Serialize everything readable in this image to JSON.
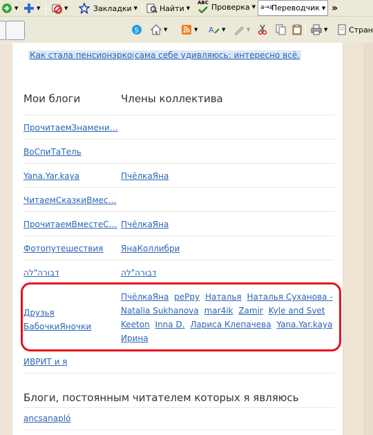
{
  "toolbar": {
    "bookmarks_label": "Закладки",
    "find_label": "Найти",
    "spellcheck_label": "Проверка",
    "spellcheck_badge": "ABC",
    "translate_label": "Переводчик",
    "translate_glyph": "a→a",
    "more_glyph": "»",
    "page_label": "Стран"
  },
  "tags": {
    "tag1": "Как стала пенсионэркой",
    "tag2": "сама себе удивляюсь: интересно всё."
  },
  "sections": {
    "my_blogs": "Мои блоги",
    "members": "Члены коллектива",
    "reader_blogs": "Блоги, постоянным читателем которых я являюсь"
  },
  "rows": [
    {
      "blog": "ПрочитаемЗнамени…",
      "member": ""
    },
    {
      "blog": "ВоСпиТаТель",
      "member": ""
    },
    {
      "blog": "Yana.Yar.kaya",
      "member": "ПчёлкаЯна"
    },
    {
      "blog": "ЧитаемСказкиВмес…",
      "member": ""
    },
    {
      "blog": "ПрочитаемВместеС…",
      "member": "ПчёлкаЯна"
    },
    {
      "blog": "Фотопутешествия",
      "member": "ЯнаКоллибри"
    },
    {
      "blog": "דבורה\"לה",
      "member": "דבורה\"לה"
    }
  ],
  "friends_row": {
    "blog_line1": "Друзья",
    "blog_line2": "БабочкиЯночки",
    "members": [
      "ПчёлкаЯна",
      "pePpy",
      "Наталья",
      "Наталья Суханова - Natalia Sukhanova",
      "mar4ik",
      "Zamir",
      "Kyle and Svet Keeton",
      "Inna D.",
      "Лариса Клепачева",
      "Yana.Yar.kaya",
      "Ирина"
    ]
  },
  "hebrew_row": {
    "blog": "ИВРИТ и я"
  },
  "reader_row": {
    "blog": "ancsanapló"
  }
}
